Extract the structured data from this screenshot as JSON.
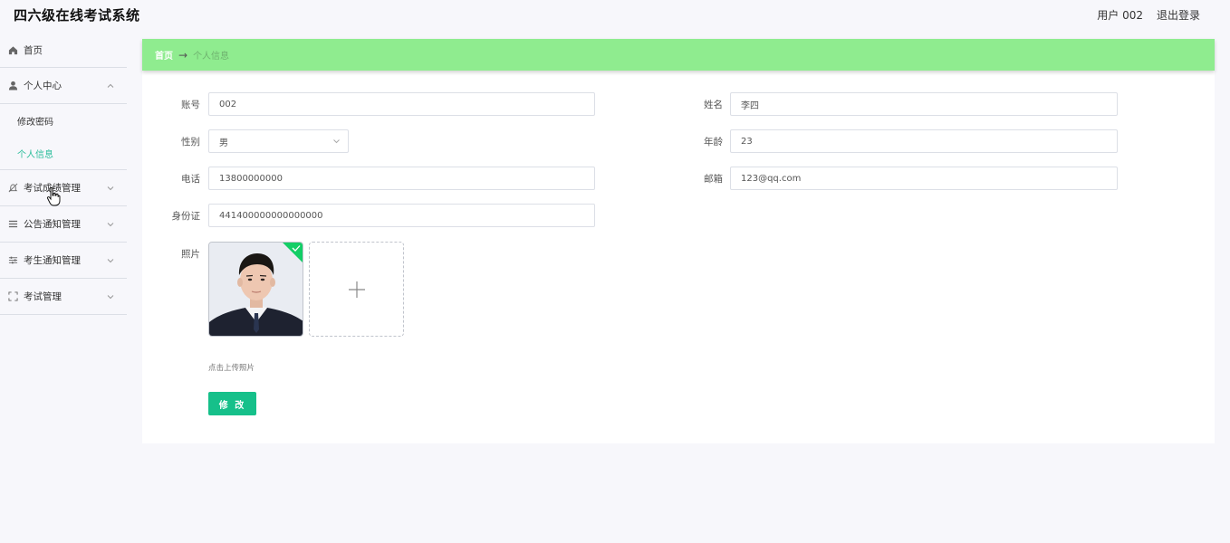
{
  "header": {
    "app_title": "四六级在线考试系统",
    "user_label": "用户 002",
    "logout_label": "退出登录"
  },
  "sidebar": {
    "items": [
      {
        "label": "首页",
        "icon": "home-icon"
      },
      {
        "label": "个人中心",
        "icon": "user-icon",
        "expanded": true,
        "children": [
          {
            "label": "修改密码"
          },
          {
            "label": "个人信息",
            "active": true
          }
        ]
      },
      {
        "label": "考试成绩管理",
        "icon": "bell-icon"
      },
      {
        "label": "公告通知管理",
        "icon": "list-icon"
      },
      {
        "label": "考生通知管理",
        "icon": "sliders-icon"
      },
      {
        "label": "考试管理",
        "icon": "fullscreen-icon"
      }
    ]
  },
  "breadcrumb": {
    "home": "首页",
    "separator": "→",
    "current": "个人信息"
  },
  "form": {
    "account": {
      "label": "账号",
      "value": "002"
    },
    "name": {
      "label": "姓名",
      "value": "李四"
    },
    "gender": {
      "label": "性别",
      "value": "男"
    },
    "age": {
      "label": "年龄",
      "value": "23"
    },
    "phone": {
      "label": "电话",
      "value": "13800000000"
    },
    "email": {
      "label": "邮箱",
      "value": "123@qq.com"
    },
    "id_card": {
      "label": "身份证",
      "value": "441400000000000000"
    },
    "photo": {
      "label": "照片",
      "upload_hint": "点击上传照片"
    },
    "submit_label": "修 改"
  },
  "colors": {
    "accent": "#2bbd9b",
    "breadcrumb_bg": "#8fec8f",
    "button": "#16c08a"
  }
}
